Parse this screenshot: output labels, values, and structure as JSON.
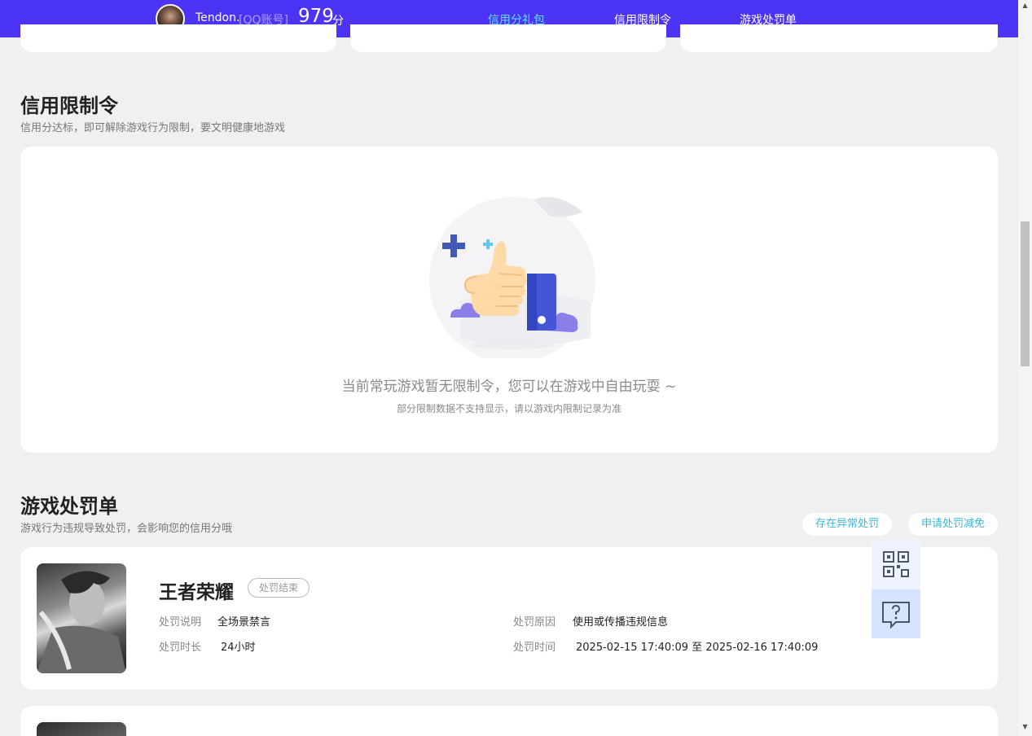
{
  "header": {
    "username": "Tendon.",
    "account_type": "[QQ账号]",
    "score": "979",
    "score_unit": "分",
    "nav": [
      {
        "label": "信用分礼包",
        "active": true
      },
      {
        "label": "信用限制令",
        "active": false
      },
      {
        "label": "游戏处罚单",
        "active": false
      }
    ]
  },
  "restriction": {
    "title": "信用限制令",
    "subtitle": "信用分达标，即可解除游戏行为限制，要文明健康地游戏",
    "empty_main": "当前常玩游戏暂无限制令，您可以在游戏中自由玩耍 ~",
    "empty_sub": "部分限制数据不支持显示，请以游戏内限制记录为准"
  },
  "penalty": {
    "title": "游戏处罚单",
    "subtitle": "游戏行为违规导致处罚，会影响您的信用分哦",
    "actions": {
      "abnormal": "存在异常处罚",
      "appeal": "申请处罚减免"
    },
    "items": [
      {
        "game": "王者荣耀",
        "status": "处罚结束",
        "desc_label": "处罚说明",
        "desc_value": "全场景禁言",
        "duration_label": "处罚时长",
        "duration_value": "24小时",
        "reason_label": "处罚原因",
        "reason_value": "使用或传播违规信息",
        "time_label": "处罚时间",
        "time_value": "2025-02-15 17:40:09 至 2025-02-16 17:40:09"
      }
    ]
  },
  "colors": {
    "header_bg": "#4c34f5",
    "accent": "#5fe0ff",
    "link": "#3ab8d8"
  }
}
